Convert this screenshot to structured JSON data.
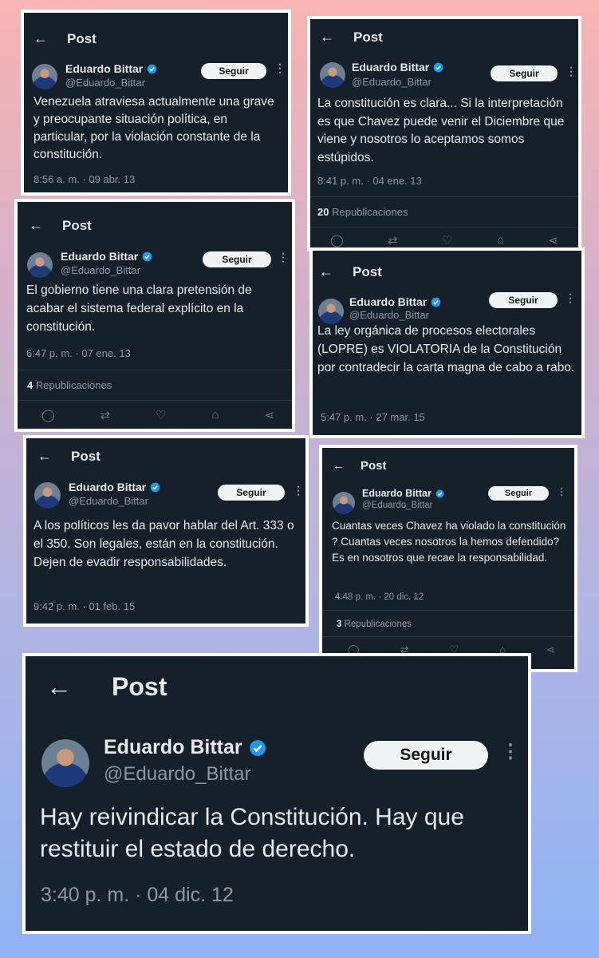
{
  "accent_color": "#1d9bf0",
  "posts": [
    {
      "header": "Post",
      "name": "Eduardo Bittar",
      "handle": "@Eduardo_Bittar",
      "follow": "Seguir",
      "text": "Venezuela atraviesa actualmente una grave y preocupante situación política, en particular, por la violación constante de la constitución.",
      "time": "8:56 a. m. · 09 abr. 13"
    },
    {
      "header": "Post",
      "name": "Eduardo Bittar",
      "handle": "@Eduardo_Bittar",
      "follow": "Seguir",
      "text": "La constitución es clara... Si la interpretación es que Chavez puede venir el Diciembre que viene y nosotros lo aceptamos somos estúpidos.",
      "time": "8:41 p. m. · 04 ene. 13",
      "reposts_count": "20",
      "reposts_label": "Republicaciones"
    },
    {
      "header": "Post",
      "name": "Eduardo Bittar",
      "handle": "@Eduardo_Bittar",
      "follow": "Seguir",
      "text": "El gobierno tiene una clara pretensión de acabar el sistema federal explícito en la constitución.",
      "time": "6:47 p. m. · 07 ene. 13",
      "reposts_count": "4",
      "reposts_label": "Republicaciones"
    },
    {
      "header": "Post",
      "name": "Eduardo Bittar",
      "handle": "@Eduardo_Bittar",
      "follow": "Seguir",
      "text": "La ley orgánica de procesos electorales (LOPRE) es VIOLATORIA de la Constitución por contradecir la carta magna de cabo a rabo.",
      "time": "5:47 p. m. · 27 mar. 15"
    },
    {
      "header": "Post",
      "name": "Eduardo Bittar",
      "handle": "@Eduardo_Bittar",
      "follow": "Seguir",
      "text": "A los políticos les da pavor hablar del Art. 333 o el 350. Son legales, están en la constitución. Dejen de evadir responsabilidades.",
      "time": "9:42 p. m. · 01 feb. 15"
    },
    {
      "header": "Post",
      "name": "Eduardo Bittar",
      "handle": "@Eduardo_Bittar",
      "follow": "Seguir",
      "text": "Cuantas veces Chavez ha violado la constitución ? Cuantas veces nosotros la hemos defendido? Es en nosotros que recae la responsabilidad.",
      "time": "4:48 p. m. · 20 dic. 12",
      "reposts_count": "3",
      "reposts_label": "Republicaciones"
    },
    {
      "header": "Post",
      "name": "Eduardo Bittar",
      "handle": "@Eduardo_Bittar",
      "follow": "Seguir",
      "text": "Hay reivindicar la Constitución. Hay que restituir el estado de derecho.",
      "time": "3:40 p. m. · 04 dic. 12"
    }
  ]
}
